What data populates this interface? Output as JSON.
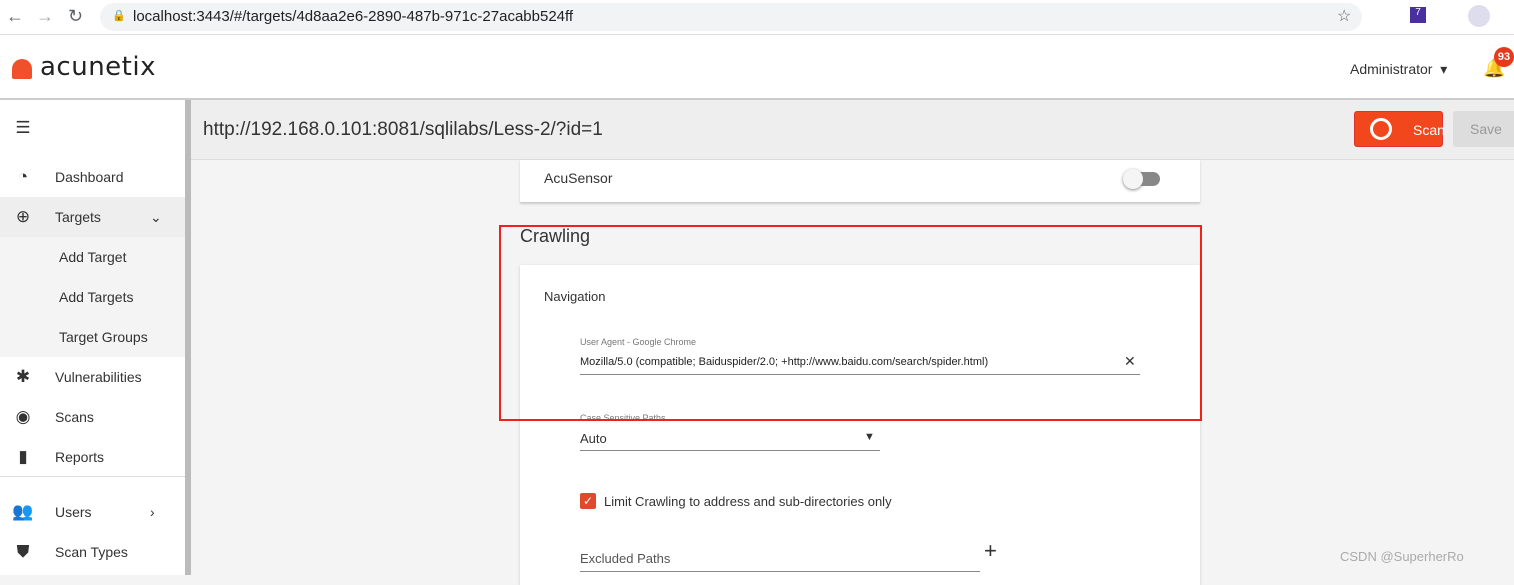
{
  "browser": {
    "url": "localhost:3443/#/targets/4d8aa2e6-2890-487b-971c-27acabb524ff",
    "ext_badge": "7"
  },
  "header": {
    "logo": "acunetix",
    "user": "Administrator",
    "notifications": "93"
  },
  "sidebar": {
    "items": [
      {
        "label": "Dashboard",
        "icon": "gauge-icon"
      },
      {
        "label": "Targets",
        "icon": "crosshair-icon"
      },
      {
        "label": "Add Target"
      },
      {
        "label": "Add Targets"
      },
      {
        "label": "Target Groups"
      },
      {
        "label": "Vulnerabilities",
        "icon": "bug-icon"
      },
      {
        "label": "Scans",
        "icon": "radar-icon"
      },
      {
        "label": "Reports",
        "icon": "file-icon"
      },
      {
        "label": "Users",
        "icon": "users-icon"
      },
      {
        "label": "Scan Types",
        "icon": "shield-icon"
      }
    ]
  },
  "toolbar": {
    "target": "http://192.168.0.101:8081/sqlilabs/Less-2/?id=1",
    "scan": "Scan",
    "save": "Save"
  },
  "main": {
    "acusensor": {
      "label": "AcuSensor",
      "enabled": false
    },
    "section": "Crawling",
    "navigation": "Navigation",
    "user_agent_label": "User Agent - Google Chrome",
    "user_agent_value": "Mozilla/5.0 (compatible; Baiduspider/2.0; +http://www.baidu.com/search/spider.html)",
    "case_label": "Case Sensitive Paths",
    "case_value": "Auto",
    "limit_label": "Limit Crawling to address and sub-directories only",
    "limit_checked": true,
    "excluded_label": "Excluded Paths"
  },
  "watermark": "CSDN @SuperherRo",
  "colors": {
    "accent": "#f2461d",
    "highlight": "#f0201a"
  }
}
